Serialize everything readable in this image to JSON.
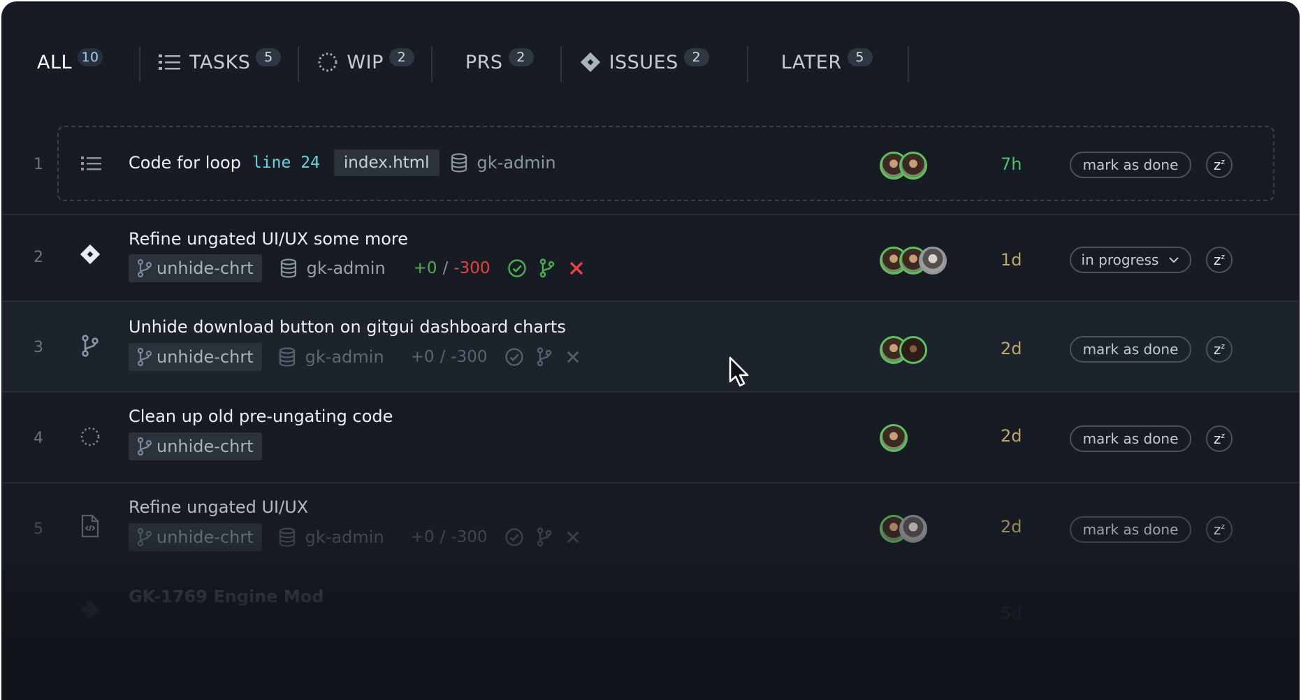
{
  "tabs": [
    {
      "label": "ALL",
      "count": "10",
      "icon": null
    },
    {
      "label": "TASKS",
      "count": "5",
      "icon": "list-icon"
    },
    {
      "label": "WIP",
      "count": "2",
      "icon": "dotted-circle-icon"
    },
    {
      "label": "PRS",
      "count": "2",
      "icon": null
    },
    {
      "label": "ISSUES",
      "count": "2",
      "icon": "diamond-icon"
    },
    {
      "label": "LATER",
      "count": "5",
      "icon": null
    }
  ],
  "rows": [
    {
      "num": "1",
      "icon": "list-icon",
      "title": "Code for loop",
      "code": "line 24",
      "file": "index.html",
      "repo": "gk-admin",
      "age": "7h",
      "action": "mark as done",
      "snooze": "z"
    },
    {
      "num": "2",
      "icon": "diamond-icon",
      "title": "Refine ungated UI/UX some more",
      "branch": "unhide-chrt",
      "repo": "gk-admin",
      "additions": "+0",
      "sep": "/",
      "deletions": "-300",
      "age": "1d",
      "action": "in progress",
      "snooze": "z"
    },
    {
      "num": "3",
      "icon": "branch-icon",
      "title": "Unhide download button on gitgui dashboard charts",
      "branch": "unhide-chrt",
      "repo": "gk-admin",
      "additions": "+0",
      "sep": "/",
      "deletions": "-300",
      "age": "2d",
      "action": "mark as done",
      "snooze": "z"
    },
    {
      "num": "4",
      "icon": "dotted-circle-icon",
      "title": "Clean up old pre-ungating code",
      "branch": "unhide-chrt",
      "age": "2d",
      "action": "mark as done",
      "snooze": "z"
    },
    {
      "num": "5",
      "icon": "code-file-icon",
      "title": "Refine ungated UI/UX",
      "branch": "unhide-chrt",
      "repo": "gk-admin",
      "additions": "+0",
      "sep": "/",
      "deletions": "-300",
      "age": "2d",
      "action": "mark as done",
      "snooze": "z"
    },
    {
      "num": "",
      "icon": "diamond-icon",
      "title": "GK-1769 Engine Mod",
      "age": "5d"
    }
  ],
  "colors": {
    "background": "#171c24",
    "additions": "#4caf50",
    "deletions": "#e54343",
    "accent_code": "#67d3e0",
    "age_recent": "#4fbe6a",
    "age": "#bfa86b"
  }
}
